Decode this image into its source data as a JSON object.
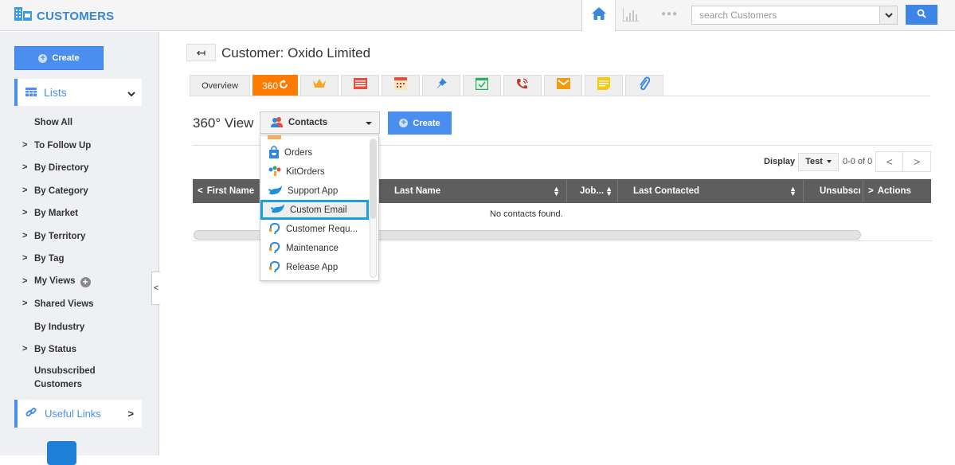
{
  "app": {
    "title": "CUSTOMERS",
    "brand_color": "#3a87d9",
    "accent_color": "#4a8ff0",
    "active_tab_color": "#ff7a00"
  },
  "topbar": {
    "home_icon": "home-icon",
    "reports_icon": "bar-chart-icon",
    "more_icon": "more-dots-icon",
    "search_placeholder": "search Customers",
    "search_value": "",
    "search_button_icon": "search-icon"
  },
  "sidebar": {
    "create_label": "Create",
    "lists_label": "Lists",
    "items": [
      {
        "label": "Show All",
        "has_arrow": false
      },
      {
        "label": "To Follow Up",
        "has_arrow": true
      },
      {
        "label": "By Directory",
        "has_arrow": true
      },
      {
        "label": "By Category",
        "has_arrow": true
      },
      {
        "label": "By Market",
        "has_arrow": true
      },
      {
        "label": "By Territory",
        "has_arrow": true
      },
      {
        "label": "By Tag",
        "has_arrow": true
      },
      {
        "label": "My Views",
        "has_arrow": true,
        "add_button": true
      },
      {
        "label": "Shared Views",
        "has_arrow": true
      },
      {
        "label": "By Industry",
        "has_arrow": false
      },
      {
        "label": "By Status",
        "has_arrow": true
      },
      {
        "label": "Unsubscribed Customers",
        "has_arrow": false
      }
    ],
    "useful_links_label": "Useful Links"
  },
  "main": {
    "back_icon": "back-arrow-icon",
    "page_title": "Customer: Oxido Limited",
    "tabs": [
      {
        "label": "Overview",
        "type": "text"
      },
      {
        "label": "360",
        "type": "text",
        "active": true,
        "icon": "refresh-icon"
      },
      {
        "icon": "crown-icon"
      },
      {
        "icon": "invoice-icon"
      },
      {
        "icon": "calendar-icon"
      },
      {
        "icon": "pin-icon"
      },
      {
        "icon": "task-check-icon"
      },
      {
        "icon": "phone-call-icon"
      },
      {
        "icon": "mail-icon"
      },
      {
        "icon": "note-icon"
      },
      {
        "icon": "paperclip-icon"
      }
    ],
    "view_title": "360° View",
    "view_select_value": "Contacts",
    "create_label": "Create",
    "dropdown_options": [
      {
        "label": "Orders",
        "icon": "shopping-bag-icon"
      },
      {
        "label": "KitOrders",
        "icon": "kit-icon"
      },
      {
        "label": "Support App",
        "icon": "leaf-icon"
      },
      {
        "label": "Custom Email",
        "icon": "leaf-icon",
        "highlighted": true
      },
      {
        "label": "Customer Requ...",
        "icon": "headset-icon"
      },
      {
        "label": "Maintenance",
        "icon": "headset-icon"
      },
      {
        "label": "Release App",
        "icon": "headset-icon"
      }
    ],
    "display_label": "Display",
    "display_value": "Test",
    "record_count": "0-0 of 0",
    "table": {
      "columns": [
        "First Name",
        "Last Name",
        "Job...",
        "Last Contacted",
        "Unsubscı",
        "Actions"
      ],
      "empty_message": "No contacts found."
    }
  }
}
